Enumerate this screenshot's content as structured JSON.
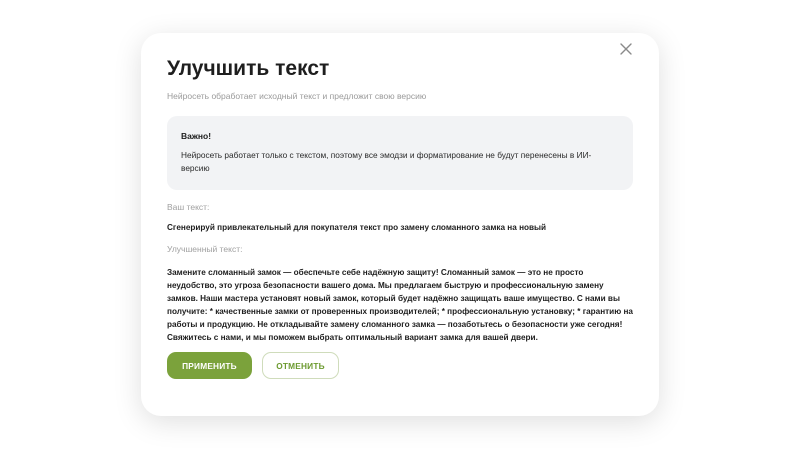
{
  "modal": {
    "title": "Улучшить текст",
    "subtitle": "Нейросеть обработает исходный текст и предложит свою версию",
    "close_icon": "close-icon",
    "notice": {
      "title": "Важно!",
      "text": "Нейросеть работает только с текстом, поэтому все эмодзи и форматирование не будут перенесены в ИИ-версию"
    },
    "your_text_label": "Ваш текст:",
    "your_text": "Сгенерируй привлекательный для покупателя текст про замену сломанного замка на новый",
    "improved_text_label": "Улучшенный текст:",
    "improved_text": "Замените сломанный замок — обеспечьте себе надёжную защиту! Сломанный замок — это не просто неудобство, это угроза безопасности вашего дома. Мы предлагаем быструю и профессиональную замену замков. Наши мастера установят новый замок, который будет надёжно защищать ваше имущество. С нами вы получите: * качественные замки от проверенных производителей; * профессиональную установку; * гарантию на работы и продукцию. Не откладывайте замену сломанного замка — позаботьтесь о безопасности уже сегодня! Свяжитесь с нами, и мы поможем выбрать оптимальный вариант замка для вашей двери.",
    "apply_label": "ПРИМЕНИТЬ",
    "cancel_label": "ОТМЕНИТЬ"
  },
  "colors": {
    "accent": "#7ba23b",
    "accent_text": "#6c9a2f",
    "notice_bg": "#f2f3f5",
    "muted_text": "#9a9a9a"
  }
}
